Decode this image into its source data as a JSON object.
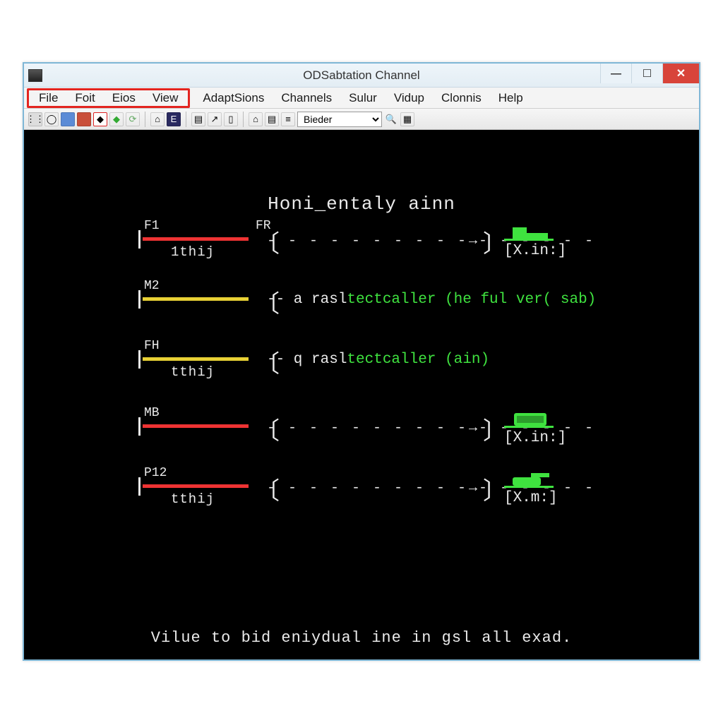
{
  "window": {
    "title": "ODSabtation Channel"
  },
  "menu": {
    "highlighted": [
      "File",
      "Foit",
      "Eios",
      "View"
    ],
    "rest": [
      "AdaptSions",
      "Channels",
      "Sulur",
      "Vidup",
      "Clonnis",
      "Help"
    ]
  },
  "toolbar": {
    "select_value": "Bieder"
  },
  "canvas": {
    "heading": "Honi_entaly ainn",
    "rows": [
      {
        "id": "F1",
        "tag": "F1",
        "tag2": "FR",
        "bar_color": "red",
        "sub": "1thij",
        "kind": "arrow",
        "endLabel": "[X.in:]",
        "sprite": "building"
      },
      {
        "id": "M2",
        "tag": "M2",
        "bar_color": "yellow",
        "kind": "text",
        "text_plain": "-- a rasl",
        "text_green": "tectcaller (he ful ver( sab)"
      },
      {
        "id": "FH",
        "tag": "FH",
        "bar_color": "yellow",
        "sub": "tthij",
        "kind": "text",
        "text_plain": "-- q rasl",
        "text_green": "tectcaller (ain)"
      },
      {
        "id": "MB",
        "tag": "MB",
        "bar_color": "red",
        "kind": "arrow",
        "endLabel": "[X.in:]",
        "sprite": "chip"
      },
      {
        "id": "P12",
        "tag": "P12",
        "bar_color": "red",
        "sub": "tthij",
        "kind": "arrow",
        "endLabel": "[X.m:]",
        "sprite": "tank"
      }
    ],
    "footer": "Vilue to bid eniydual ine in gsl all exad."
  }
}
